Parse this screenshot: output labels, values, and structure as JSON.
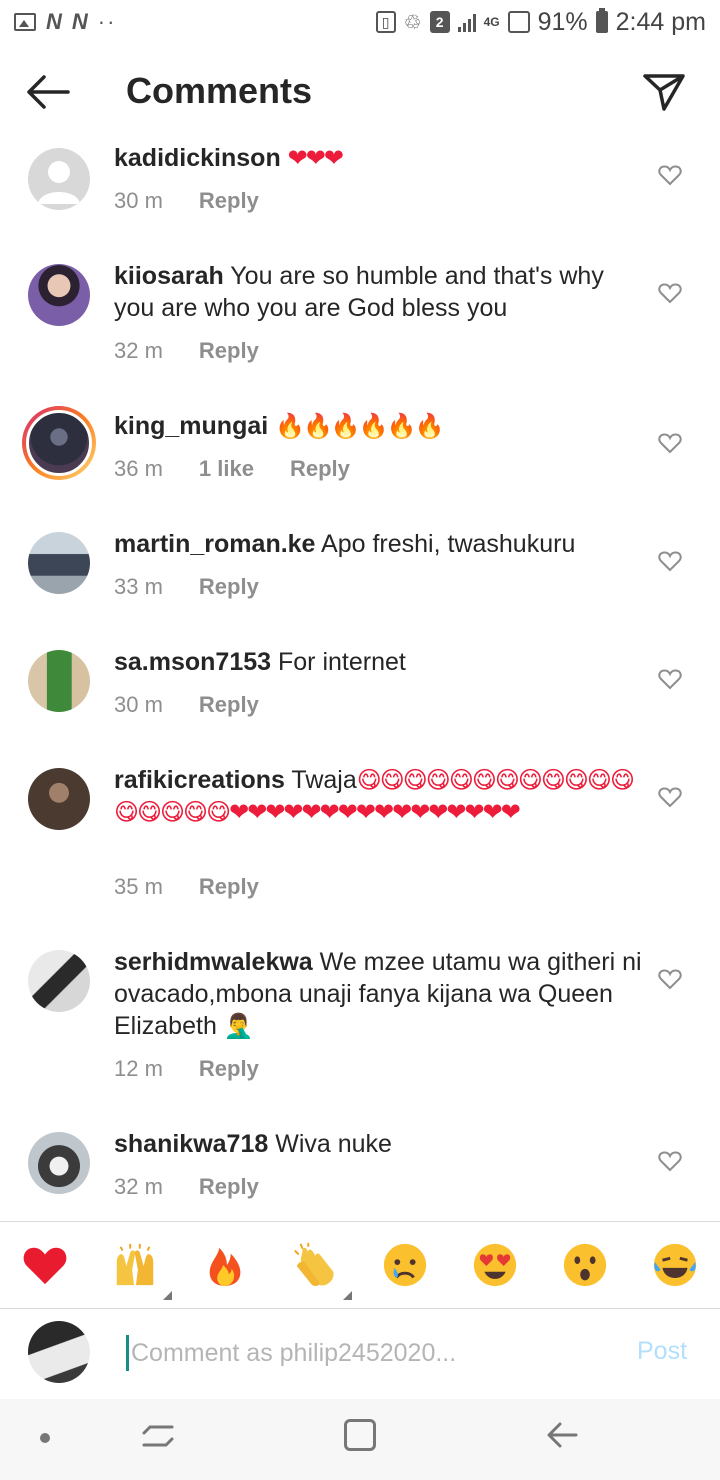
{
  "status_bar": {
    "left_icons": [
      "image-icon",
      "n-icon",
      "n-icon",
      "dots-icon"
    ],
    "sim_badge": "2",
    "network": "4G",
    "battery": "91%",
    "time": "2:44 pm"
  },
  "header": {
    "title": "Comments"
  },
  "comments": [
    {
      "user": "kadidickinson",
      "text": "",
      "emoji": "❤❤❤",
      "emoji_kind": "heart",
      "time": "30 m",
      "likes": "",
      "reply": "Reply"
    },
    {
      "user": "kiiosarah",
      "text": "You are so humble and that's why you are who you are God bless you",
      "emoji": "",
      "emoji_kind": "",
      "time": "32 m",
      "likes": "",
      "reply": "Reply"
    },
    {
      "user": "king_mungai",
      "text": "",
      "emoji": "🔥🔥🔥🔥🔥🔥",
      "emoji_kind": "fire",
      "time": "36 m",
      "likes": "1 like",
      "reply": "Reply"
    },
    {
      "user": "martin_roman.ke",
      "text": "Apo freshi, twashukuru",
      "emoji": "",
      "emoji_kind": "",
      "time": "33 m",
      "likes": "",
      "reply": "Reply"
    },
    {
      "user": "sa.mson7153",
      "text": "For internet",
      "emoji": "",
      "emoji_kind": "",
      "time": "30 m",
      "likes": "",
      "reply": "Reply"
    },
    {
      "user": "rafikicreations",
      "text": "Twaja",
      "emoji": "😋😋😋😋😋😋😋😋😋😋😋😋😋😋😋😋😋❤❤❤❤❤❤❤❤❤❤❤❤❤❤❤❤",
      "emoji_kind": "mixed",
      "time": "35 m",
      "likes": "",
      "reply": "Reply"
    },
    {
      "user": "serhidmwalekwa",
      "text": "We mzee utamu wa githeri ni ovacado,mbona unaji fanya kijana wa Queen Elizabeth",
      "emoji": "🤦‍♂️",
      "emoji_kind": "facepalm",
      "time": "12 m",
      "likes": "",
      "reply": "Reply"
    },
    {
      "user": "shanikwa718",
      "text": "Wiva nuke",
      "emoji": "",
      "emoji_kind": "",
      "time": "32 m",
      "likes": "",
      "reply": "Reply"
    }
  ],
  "emoji_bar": [
    {
      "glyph": "❤",
      "icon": "red-heart-icon"
    },
    {
      "glyph": "🙌",
      "icon": "raising-hands-icon"
    },
    {
      "glyph": "🔥",
      "icon": "fire-icon"
    },
    {
      "glyph": "👏",
      "icon": "clapping-hands-icon"
    },
    {
      "glyph": "😢",
      "icon": "crying-face-icon"
    },
    {
      "glyph": "😍",
      "icon": "heart-eyes-icon"
    },
    {
      "glyph": "😮",
      "icon": "surprised-face-icon"
    },
    {
      "glyph": "😂",
      "icon": "tears-of-joy-icon"
    }
  ],
  "input": {
    "placeholder": "Comment as philip2452020...",
    "value": "",
    "post_label": "Post"
  },
  "colors": {
    "text": "#262626",
    "meta": "#8e8e8e",
    "post_disabled": "#b2dffc",
    "heart": "#ed1c3a"
  }
}
